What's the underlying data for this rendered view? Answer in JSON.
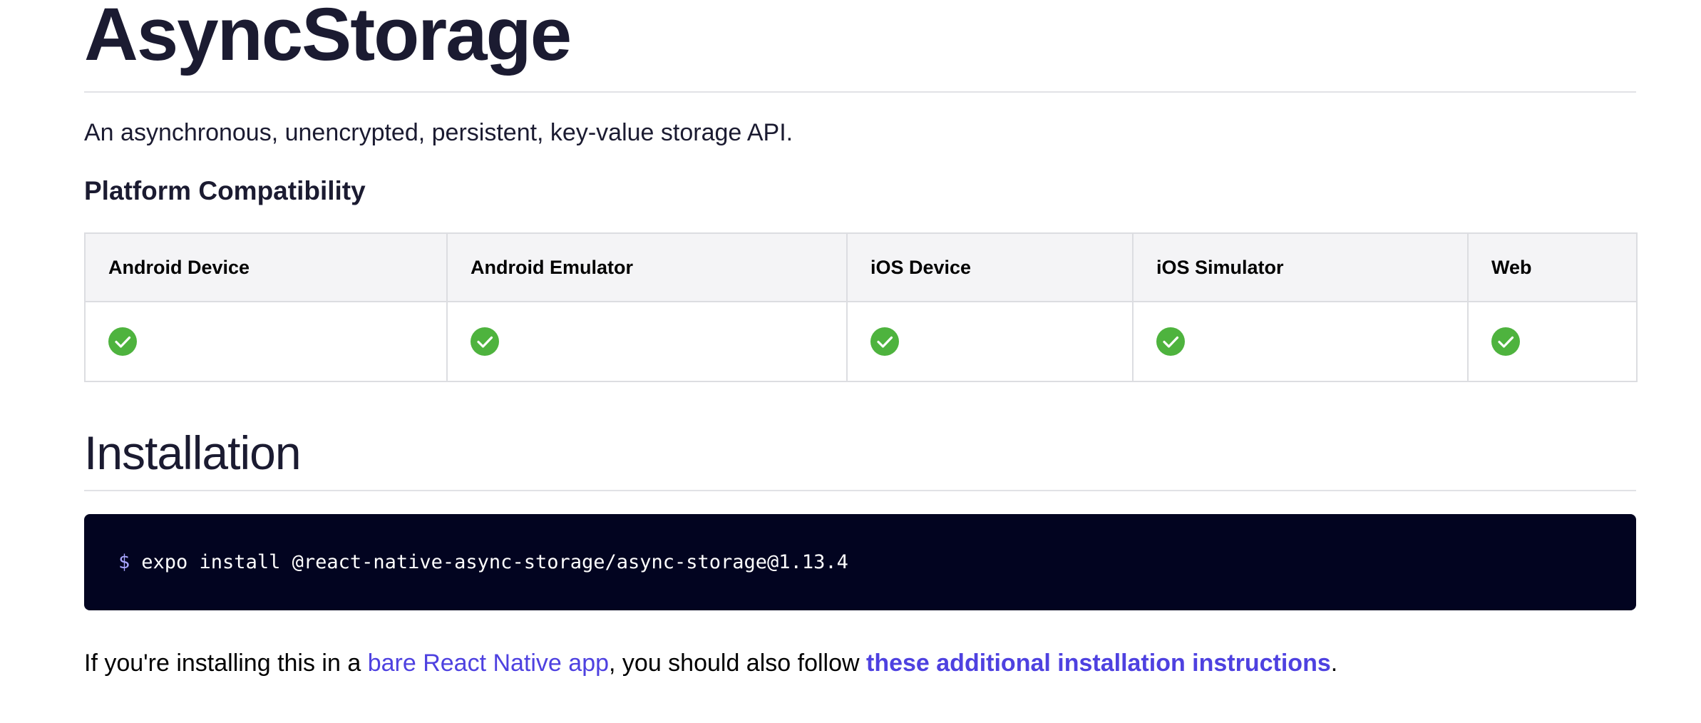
{
  "title": "AsyncStorage",
  "description": "An asynchronous, unencrypted, persistent, key-value storage API.",
  "compatibility": {
    "heading": "Platform Compatibility",
    "columns": [
      "Android Device",
      "Android Emulator",
      "iOS Device",
      "iOS Simulator",
      "Web"
    ],
    "supported": [
      true,
      true,
      true,
      true,
      true
    ],
    "check_color": "#4eb33e"
  },
  "installation": {
    "heading": "Installation",
    "prompt": "$",
    "command": "expo install @react-native-async-storage/async-storage@1.13.4",
    "note_prefix": "If you're installing this in a ",
    "link_bare": "bare React Native app",
    "note_middle": ", you should also follow ",
    "link_instructions": "these additional installation instructions",
    "note_suffix": "."
  },
  "colors": {
    "text": "#1b1b31",
    "link": "#4e41e0",
    "code_bg": "#020420"
  }
}
